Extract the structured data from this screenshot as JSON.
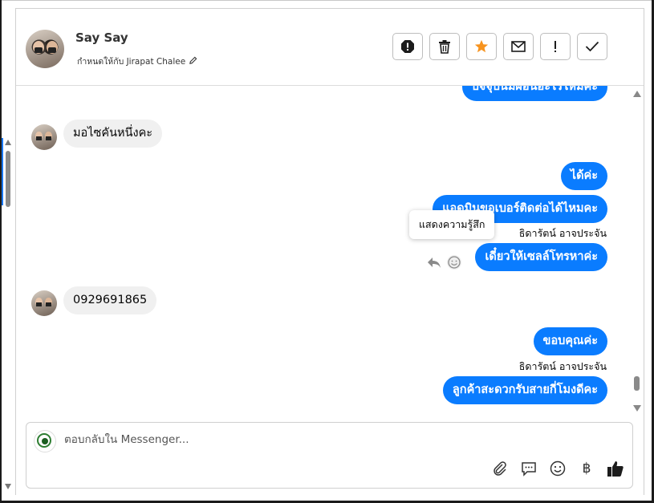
{
  "contact": {
    "name": "Say Say",
    "assigned_to": "กำหนดให้กับ Jirapat Chalee"
  },
  "toolbar": {
    "spam_icon": "octagon-alert-icon",
    "delete_icon": "trash-icon",
    "star_icon": "star-icon",
    "mail_icon": "envelope-icon",
    "flag_icon": "exclamation-icon",
    "done_icon": "check-icon",
    "star_color": "#f7931e"
  },
  "conversation": {
    "partial_top_message": "ปัจจุบันมีผ่อนอะไรไหมคะ",
    "incoming_1": "มอไซคันหนึ่งคะ",
    "outgoing_1": "ได้ค่ะ",
    "outgoing_2": "แอดมินขอเบอร์ติดต่อได้ไหมคะ",
    "sender_1": "ธิดารัตน์ อาจประจัน",
    "tooltip": "แสดงความรู้สึก",
    "outgoing_3": "เดี๋ยวให้เซลล์โทรหาค่ะ",
    "incoming_2": "0929691865",
    "outgoing_4": "ขอบคุณค่ะ",
    "sender_2": "ธิดารัตน์ อาจประจัน",
    "outgoing_5": "ลูกค้าสะดวกรับสายกี่โมงดีคะ"
  },
  "composer": {
    "placeholder": "ตอบกลับใน Messenger...",
    "currency_symbol": "฿"
  },
  "colors": {
    "outgoing_bubble": "#0a7cff",
    "incoming_bubble": "#f0f0f0"
  }
}
